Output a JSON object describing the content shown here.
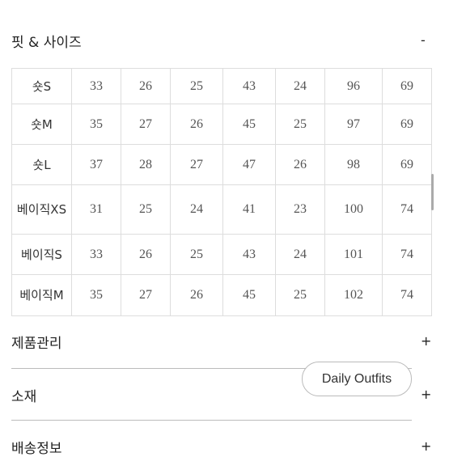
{
  "fit": {
    "title": "핏 & 사이즈",
    "toggle": "-"
  },
  "rows": [
    {
      "label": "숏S",
      "values": [
        "33",
        "26",
        "25",
        "43",
        "24",
        "96",
        "69"
      ]
    },
    {
      "label": "숏M",
      "values": [
        "35",
        "27",
        "26",
        "45",
        "25",
        "97",
        "69"
      ]
    },
    {
      "label": "숏L",
      "values": [
        "37",
        "28",
        "27",
        "47",
        "26",
        "98",
        "69"
      ]
    },
    {
      "label": "베이직XS",
      "values": [
        "31",
        "25",
        "24",
        "41",
        "23",
        "100",
        "74"
      ]
    },
    {
      "label": "베이직S",
      "values": [
        "33",
        "26",
        "25",
        "43",
        "24",
        "101",
        "74"
      ]
    },
    {
      "label": "베이직M",
      "values": [
        "35",
        "27",
        "26",
        "45",
        "25",
        "102",
        "74"
      ]
    }
  ],
  "sections": [
    {
      "title": "제품관리",
      "toggle": "+"
    },
    {
      "title": "소재",
      "toggle": "+"
    },
    {
      "title": "배송정보",
      "toggle": "+"
    }
  ],
  "pill": {
    "label": "Daily Outfits"
  }
}
